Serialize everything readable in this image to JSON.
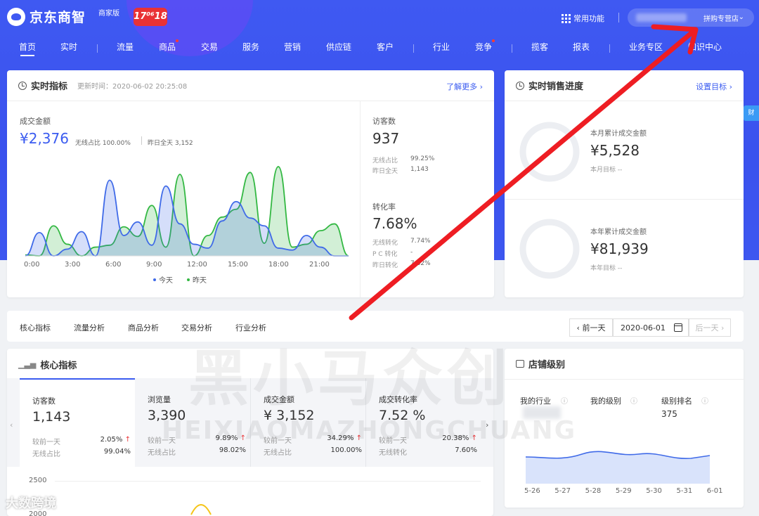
{
  "brand": {
    "logo_text": "京东商智",
    "merchant_badge": "商家版",
    "promo_badge": "17⁰⁶18"
  },
  "header": {
    "quick_functions": "常用功能",
    "store_name": "拼购专营店"
  },
  "nav": {
    "items": [
      "首页",
      "实时",
      "流量",
      "商品",
      "交易",
      "服务",
      "营销",
      "供应链",
      "客户",
      "行业",
      "竞争",
      "揽客",
      "报表",
      "业务专区",
      "知识中心"
    ]
  },
  "realtime": {
    "title": "实时指标",
    "update_time": "更新时间：2020-06-02 20:25:08",
    "more_link": "了解更多 ›",
    "sales_label": "成交金额",
    "sales_value": "¥2,376",
    "wireless_ratio": "无线占比  100.00%",
    "yesterday_all": "昨日全天  3,152",
    "visitors_label": "访客数",
    "visitors_value": "937",
    "visitors_wireless": "无线占比",
    "visitors_wireless_val": "99.25%",
    "visitors_yesterday": "昨日全天",
    "visitors_yesterday_val": "1,143",
    "conv_label": "转化率",
    "conv_value": "7.68%",
    "conv_wireless": "无线转化",
    "conv_wireless_val": "7.74%",
    "conv_pc": "P C 转化",
    "conv_pc_val": "-",
    "conv_yesterday": "昨日转化",
    "conv_yesterday_val": "7.62%",
    "x_ticks": [
      "0:00",
      "3:00",
      "6:00",
      "9:00",
      "12:00",
      "15:00",
      "18:00",
      "21:00"
    ],
    "legend_today": "今天",
    "legend_yesterday": "昨天"
  },
  "chart_data": {
    "type": "area",
    "x": [
      0,
      1,
      2,
      3,
      4,
      5,
      6,
      7,
      8,
      9,
      10,
      11,
      12,
      13,
      14,
      15,
      16,
      17,
      18,
      19,
      20,
      21,
      22,
      23
    ],
    "series": [
      {
        "name": "今天",
        "values": [
          0,
          240,
          0,
          70,
          250,
          0,
          780,
          210,
          350,
          110,
          720,
          330,
          120,
          80,
          360,
          560,
          390,
          310,
          80,
          60,
          210,
          90,
          0,
          0
        ]
      },
      {
        "name": "昨天",
        "values": [
          10,
          0,
          310,
          120,
          0,
          90,
          110,
          300,
          200,
          520,
          90,
          840,
          0,
          210,
          400,
          480,
          860,
          130,
          920,
          90,
          120,
          260,
          330,
          0
        ]
      }
    ],
    "ylim": [
      0,
      1000
    ],
    "colors": {
      "today": "#3f6ae8",
      "yesterday": "#33b843"
    }
  },
  "sales_progress": {
    "title": "实时销售进度",
    "set_goal": "设置目标 ›",
    "month_label": "本月累计成交金额",
    "month_value": "¥5,528",
    "month_goal": "本月目标  --",
    "year_label": "本年累计成交金额",
    "year_value": "¥81,939",
    "year_goal": "本年目标  --"
  },
  "analysis_tabs": {
    "items": [
      "核心指标",
      "流量分析",
      "商品分析",
      "交易分析",
      "行业分析"
    ],
    "prev_day": "‹ 前一天",
    "date": "2020-06-01",
    "next_day": "后一天 ›"
  },
  "core": {
    "title": "核心指标",
    "kpis": [
      {
        "name": "访客数",
        "value": "1,143",
        "cmp_label": "较前一天",
        "cmp_val": "2.05%",
        "sub_label": "无线占比",
        "sub_val": "99.04%"
      },
      {
        "name": "浏览量",
        "value": "3,390",
        "cmp_label": "较前一天",
        "cmp_val": "9.89%",
        "sub_label": "无线占比",
        "sub_val": "98.02%"
      },
      {
        "name": "成交金额",
        "value": "¥ 3,152",
        "cmp_label": "较前一天",
        "cmp_val": "34.29%",
        "sub_label": "无线占比",
        "sub_val": "100.00%"
      },
      {
        "name": "成交转化率",
        "value": "7.52 %",
        "cmp_label": "较前一天",
        "cmp_val": "20.38%",
        "sub_label": "无线转化",
        "sub_val": "7.60%"
      }
    ],
    "y_ticks": [
      "2500",
      "2000"
    ]
  },
  "store_level": {
    "title": "店铺级别",
    "col1": "我的行业",
    "col2": "我的级别",
    "col3": "级别排名",
    "rank_value": "375",
    "x_ticks": [
      "5-26",
      "5-27",
      "5-28",
      "5-29",
      "5-30",
      "5-31",
      "6-01"
    ]
  },
  "watermarks": {
    "main": "黑小马众创",
    "pinyin": "HEIXIAOMAZHONGCHUANG",
    "footer": "大数跨境"
  }
}
